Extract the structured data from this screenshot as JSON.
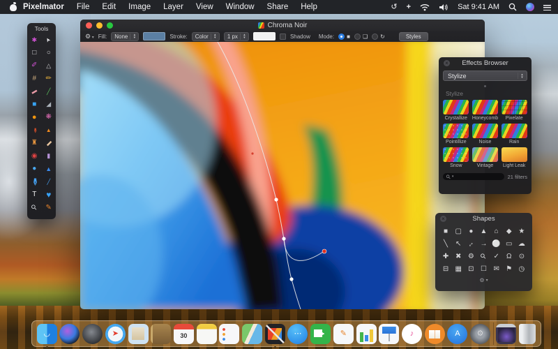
{
  "menu_bar": {
    "items": [
      "Pixelmator",
      "File",
      "Edit",
      "Image",
      "Layer",
      "View",
      "Window",
      "Share",
      "Help"
    ],
    "clock": "Sat 9:41 AM",
    "status_icons": [
      "time-machine-icon",
      "move-icon",
      "wifi-icon",
      "volume-icon",
      "spotlight-icon",
      "siri-icon",
      "notification-center-icon"
    ]
  },
  "tools_panel": {
    "title": "Tools",
    "tools": [
      {
        "name": "quick-select-tool",
        "glyph": "✱",
        "color": "#cf52d2",
        "size": 9
      },
      {
        "name": "move-tool",
        "glyph": "➤",
        "color": "#e9e9ec",
        "rotate": -120,
        "size": 8
      },
      {
        "name": "rect-marquee-tool",
        "glyph": "□",
        "color": "#d9d9dc",
        "size": 10
      },
      {
        "name": "ellipse-marquee-tool",
        "glyph": "○",
        "color": "#d9d9dc",
        "size": 10
      },
      {
        "name": "lasso-tool",
        "glyph": "✐",
        "color": "#cf52d2",
        "size": 10
      },
      {
        "name": "polygon-lasso-tool",
        "glyph": "△",
        "color": "#c6c6c9",
        "size": 9
      },
      {
        "name": "crop-tool",
        "glyph": "#",
        "color": "#c9a87c",
        "size": 10
      },
      {
        "name": "pencil-tool",
        "glyph": "✏",
        "color": "#e6b13c",
        "size": 10
      },
      {
        "name": "eraser-tool",
        "glyph": "▬",
        "color": "#e89aa6",
        "size": 8,
        "rotate": -30
      },
      {
        "name": "slice-tool",
        "glyph": "╱",
        "color": "#5abf5e",
        "size": 9
      },
      {
        "name": "shape-rect-tool",
        "glyph": "■",
        "color": "#38a3f2",
        "size": 10
      },
      {
        "name": "bucket-tool",
        "glyph": "◢",
        "color": "#aab1b9",
        "size": 9
      },
      {
        "name": "gradient-tool",
        "glyph": "●",
        "color": "#f0950f",
        "size": 11
      },
      {
        "name": "color-brush-tool",
        "glyph": "❋",
        "color": "#df6cb4",
        "size": 10
      },
      {
        "name": "brush-tool",
        "glyph": "✒",
        "color": "#d14c28",
        "rotate": 90,
        "size": 10
      },
      {
        "name": "burn-tool",
        "glyph": "▲",
        "color": "#ef8a20",
        "size": 8
      },
      {
        "name": "stamp-tool",
        "glyph": "♜",
        "color": "#e6953e",
        "size": 10
      },
      {
        "name": "heal-tool",
        "glyph": "▬",
        "color": "#e8c59e",
        "rotate": -45,
        "size": 8
      },
      {
        "name": "red-eye-tool",
        "glyph": "◉",
        "color": "#dd4242",
        "size": 10
      },
      {
        "name": "sponge-tool",
        "glyph": "▮",
        "color": "#b692d6",
        "size": 9
      },
      {
        "name": "blur-tool",
        "glyph": "●",
        "color": "#4aa9f2",
        "size": 10
      },
      {
        "name": "sharpen-tool",
        "glyph": "▲",
        "color": "#3b89ea",
        "size": 9
      },
      {
        "name": "pen-tool",
        "glyph": "✒",
        "color": "#46a2f4",
        "rotate": 90,
        "size": 15
      },
      {
        "name": "freehand-pen-tool",
        "glyph": "╱",
        "color": "#46a2f4",
        "size": 8
      },
      {
        "name": "type-tool",
        "glyph": "T",
        "color": "#ededef",
        "size": 10
      },
      {
        "name": "heart-shape-tool",
        "glyph": "♥",
        "color": "#38a2f6",
        "size": 12
      },
      {
        "name": "zoom-tool",
        "glyph": "⚲",
        "color": "#cfd2d6",
        "rotate": -45,
        "size": 10
      },
      {
        "name": "eyedropper-tool",
        "glyph": "✎",
        "color": "#e8842c",
        "size": 10
      }
    ]
  },
  "document_window": {
    "title": "Chroma Noir",
    "toolbar": {
      "gear_icon": "⚙",
      "fill_label": "Fill:",
      "fill_value": "None",
      "fill_swatch": "#5b7fa3",
      "stroke_label": "Stroke:",
      "stroke_value": "Color",
      "stroke_width": "1 px",
      "stroke_swatch": "#f2f2f2",
      "shadow_label": "Shadow",
      "mode_label": "Mode:",
      "mode_icons": [
        "■",
        "❏",
        "↻"
      ],
      "styles_button": "Styles"
    }
  },
  "effects_browser": {
    "title": "Effects Browser",
    "category_value": "Stylize",
    "section_label": "Stylize",
    "filters": [
      {
        "label": "Crystallize",
        "kind": "rainbow"
      },
      {
        "label": "Honeycomb",
        "kind": "rainbow"
      },
      {
        "label": "Pixelate",
        "kind": "pixel"
      },
      {
        "label": "Pointillize",
        "kind": "dots"
      },
      {
        "label": "Noise",
        "kind": "rainbow"
      },
      {
        "label": "Rain",
        "kind": "rainbow"
      },
      {
        "label": "Snow",
        "kind": "dots"
      },
      {
        "label": "Vintage",
        "kind": "vintage"
      },
      {
        "label": "Light Leak",
        "kind": "lightleak"
      }
    ],
    "count_label": "21 filters",
    "search_icon": "⚲"
  },
  "shapes_panel": {
    "title": "Shapes",
    "gear_icon": "⚙",
    "shapes": [
      {
        "name": "rectangle",
        "glyph": "■"
      },
      {
        "name": "rounded-rectangle",
        "glyph": "▢"
      },
      {
        "name": "circle",
        "glyph": "●"
      },
      {
        "name": "triangle",
        "glyph": "▲"
      },
      {
        "name": "pentagon",
        "glyph": "⌂"
      },
      {
        "name": "diamond",
        "glyph": "◆"
      },
      {
        "name": "star",
        "glyph": "★"
      },
      {
        "name": "line",
        "glyph": "╲"
      },
      {
        "name": "arrow-diagonal",
        "glyph": "↖"
      },
      {
        "name": "arrow-double",
        "glyph": "↔",
        "rotate": -45
      },
      {
        "name": "arrow-right",
        "glyph": "→"
      },
      {
        "name": "speech-bubble-oval",
        "glyph": "⚪"
      },
      {
        "name": "speech-bubble-rect",
        "glyph": "▭"
      },
      {
        "name": "cloud",
        "glyph": "☁"
      },
      {
        "name": "plus",
        "glyph": "✚"
      },
      {
        "name": "cross",
        "glyph": "✖"
      },
      {
        "name": "gear",
        "glyph": "⚙"
      },
      {
        "name": "magnifier",
        "glyph": "⚲",
        "rotate": -45
      },
      {
        "name": "checkmark",
        "glyph": "✓"
      },
      {
        "name": "lock",
        "glyph": "Ω"
      },
      {
        "name": "eye",
        "glyph": "⊙"
      },
      {
        "name": "folder",
        "glyph": "⊟"
      },
      {
        "name": "picture",
        "glyph": "▦"
      },
      {
        "name": "camera",
        "glyph": "⊡"
      },
      {
        "name": "monitor",
        "glyph": "☐"
      },
      {
        "name": "envelope",
        "glyph": "✉"
      },
      {
        "name": "bookmark",
        "glyph": "⚑"
      },
      {
        "name": "clock",
        "glyph": "◷"
      }
    ]
  },
  "dock": {
    "apps": [
      {
        "id": "finder",
        "glyph": "◡",
        "glyph_color": "#ffffff"
      },
      {
        "id": "siri"
      },
      {
        "id": "launchpad"
      },
      {
        "id": "safari",
        "glyph": "➤",
        "glyph_color": "#e23c2c"
      },
      {
        "id": "mail"
      },
      {
        "id": "contacts"
      },
      {
        "id": "calendar",
        "text": "30"
      },
      {
        "id": "notes"
      },
      {
        "id": "reminders"
      },
      {
        "id": "maps"
      },
      {
        "id": "pixelmator"
      },
      {
        "id": "messages",
        "glyph": "⋯",
        "glyph_color": "#ffffff"
      },
      {
        "id": "facetime"
      },
      {
        "id": "pages",
        "glyph": "✎",
        "glyph_color": "#e8842c"
      },
      {
        "id": "numbers"
      },
      {
        "id": "keynote"
      },
      {
        "id": "itunes",
        "glyph": "♪",
        "glyph_color": "#e8509a"
      },
      {
        "id": "ibooks"
      },
      {
        "id": "appstore",
        "glyph": "A",
        "glyph_color": "#ffffff"
      },
      {
        "id": "sysprefs",
        "glyph": "⚙",
        "glyph_color": "#d8dadc"
      },
      {
        "id": "divider"
      },
      {
        "id": "downloads"
      },
      {
        "id": "trash"
      }
    ],
    "running": [
      "finder",
      "pixelmator"
    ]
  }
}
